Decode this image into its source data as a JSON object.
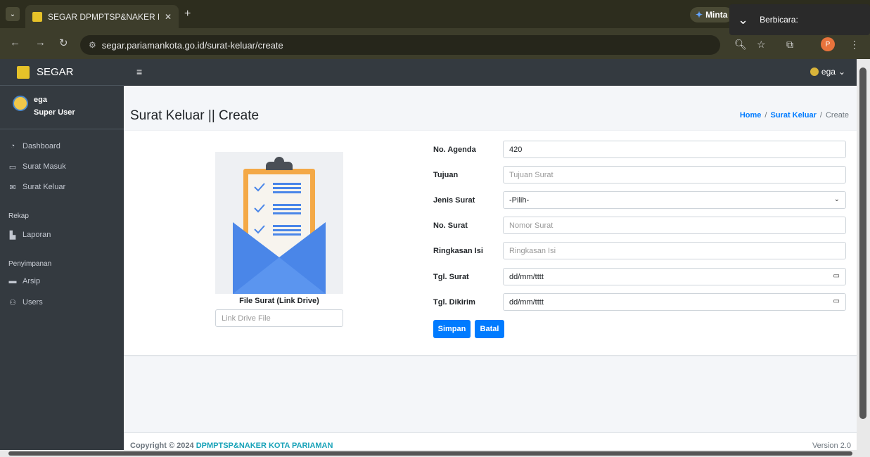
{
  "browser": {
    "tab_title": "SEGAR DPMPTSP&NAKER Kota",
    "tab_close": "✕",
    "new_tab": "+",
    "address": "segar.pariamankota.go.id/surat-keluar/create",
    "gemini_label": "Minta",
    "speak_label": "Berbicara:",
    "profile_initial": "P"
  },
  "navbar": {
    "brand": "SEGAR",
    "user": "ega"
  },
  "sidebar": {
    "user_name": "ega",
    "user_role": "Super User",
    "items": [
      {
        "label": "Dashboard",
        "icon": "dashboard-icon"
      },
      {
        "label": "Surat Masuk",
        "icon": "inbox-icon"
      },
      {
        "label": "Surat Keluar",
        "icon": "envelope-icon"
      }
    ],
    "header_rekap": "Rekap",
    "laporan": "Laporan",
    "header_penyimpanan": "Penyimpanan",
    "arsip": "Arsip",
    "users": "Users"
  },
  "page": {
    "title": "Surat Keluar || Create",
    "breadcrumb": {
      "home": "Home",
      "parent": "Surat Keluar",
      "current": "Create"
    }
  },
  "form": {
    "file_label": "File Surat (Link Drive)",
    "file_placeholder": "Link Drive File",
    "no_agenda_label": "No. Agenda",
    "no_agenda_value": "420",
    "tujuan_label": "Tujuan",
    "tujuan_placeholder": "Tujuan Surat",
    "jenis_label": "Jenis Surat",
    "jenis_value": "-Pilih-",
    "no_surat_label": "No. Surat",
    "no_surat_placeholder": "Nomor Surat",
    "ringkasan_label": "Ringkasan Isi",
    "ringkasan_placeholder": "Ringkasan Isi",
    "tgl_surat_label": "Tgl. Surat",
    "tgl_surat_value": "dd/mm/tttt",
    "tgl_dikirim_label": "Tgl. Dikirim",
    "tgl_dikirim_value": "dd/mm/tttt",
    "save_label": "Simpan",
    "cancel_label": "Batal"
  },
  "footer": {
    "copyright_prefix": "Copyright © 2024",
    "org": "DPMPTSP&NAKER KOTA PARIAMAN",
    "version": "Version 2.0"
  },
  "colors": {
    "primary": "#007bff",
    "sidebar_bg": "#343a40",
    "content_bg": "#f4f6f9"
  }
}
